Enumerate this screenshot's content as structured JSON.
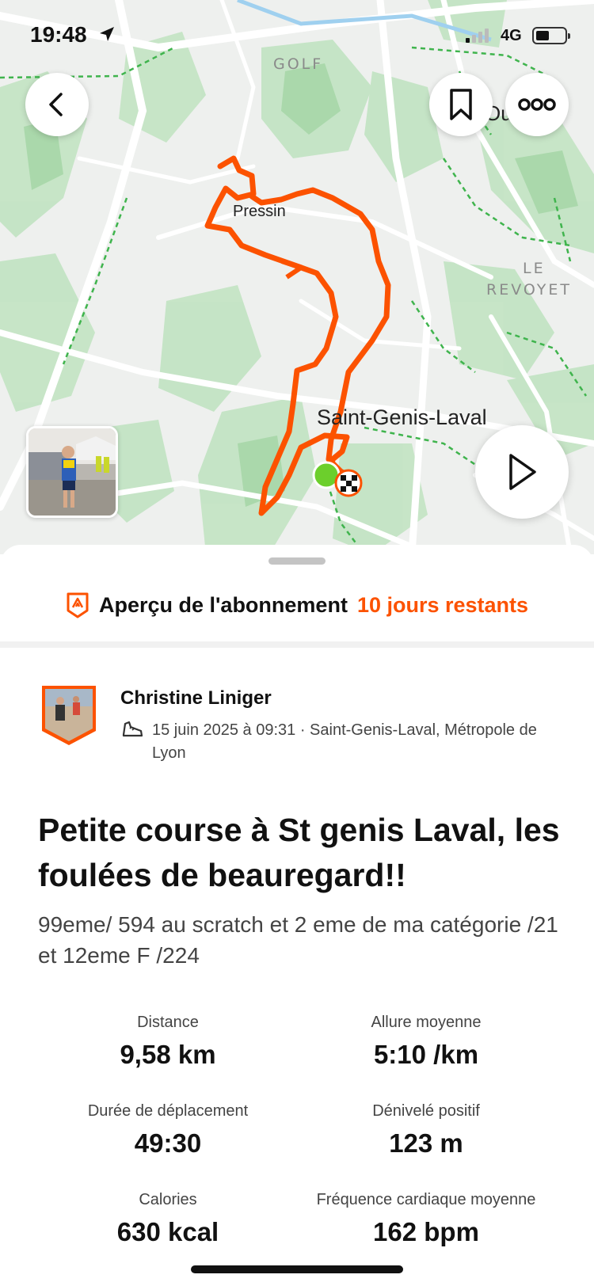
{
  "status_bar": {
    "time": "19:48",
    "network": "4G"
  },
  "map": {
    "labels": {
      "golf": "GOLF",
      "revoyet_1": "LE",
      "revoyet_2": "REVOYET",
      "pressin": "Pressin",
      "saint_genis": "Saint-Genis-Laval",
      "partial_place": "Ou"
    },
    "route_color": "#fc5200"
  },
  "header_buttons": {
    "back_icon": "chevron-left-icon",
    "bookmark_icon": "bookmark-icon",
    "more_icon": "more-icon"
  },
  "promo": {
    "title": "Aperçu de l'abonnement",
    "accent": "10 jours restants",
    "accent_color": "#fc5200"
  },
  "athlete": {
    "name": "Christine  Liniger",
    "meta": "15 juin 2025 à 09:31 · Saint-Genis-Laval, Métropole de Lyon"
  },
  "activity": {
    "title": "Petite course à St genis Laval, les foulées de beauregard!!",
    "description": "99eme/ 594 au scratch et 2 eme de ma catégorie /21  et 12eme F /224"
  },
  "stats": [
    {
      "label": "Distance",
      "value": "9,58 km"
    },
    {
      "label": "Allure moyenne",
      "value": "5:10 /km"
    },
    {
      "label": "Durée de déplacement",
      "value": "49:30"
    },
    {
      "label": "Dénivelé positif",
      "value": "123 m"
    },
    {
      "label": "Calories",
      "value": "630 kcal"
    },
    {
      "label": "Fréquence cardiaque moyenne",
      "value": "162 bpm"
    }
  ]
}
